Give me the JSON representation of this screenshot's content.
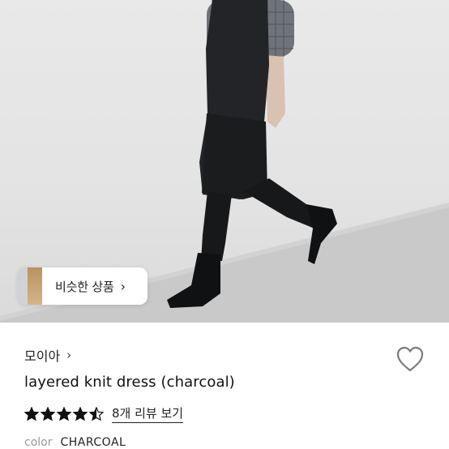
{
  "product_image": {
    "alt_icon": "product-photo"
  },
  "similar_products": {
    "label": "비슷한 상품",
    "chevron": "›"
  },
  "shop": {
    "name": "모이아",
    "chevron": "›"
  },
  "favorite": {
    "icon": "heart-outline-icon"
  },
  "product": {
    "title": "layered knit dress (charcoal)"
  },
  "rating": {
    "value": 4.5,
    "max": 5,
    "review_link": "8개 리뷰 보기"
  },
  "option": {
    "label": "color",
    "value": "CHARCOAL"
  },
  "colors": {
    "text": "#111111",
    "muted": "#9a9a9a",
    "star": "#111111"
  }
}
